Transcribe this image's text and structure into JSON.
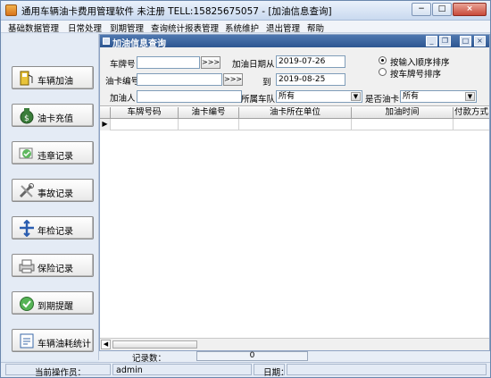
{
  "window": {
    "title": "通用车辆油卡费用管理软件 未注册 TELL:15825675057 - [加油信息查询]",
    "controls": {
      "minimize": "−",
      "maximize": "□",
      "close": "×"
    }
  },
  "menu": [
    "基础数据管理",
    "日常处理",
    "到期管理",
    "查询统计报表管理",
    "系统维护",
    "退出管理",
    "帮助"
  ],
  "sidebar": [
    {
      "label": "车辆加油",
      "icon": "fuel-pump-icon"
    },
    {
      "label": "油卡充值",
      "icon": "money-bag-icon"
    },
    {
      "label": "违章记录",
      "icon": "violation-icon"
    },
    {
      "label": "事故记录",
      "icon": "accident-tools-icon"
    },
    {
      "label": "年检记录",
      "icon": "inspection-icon"
    },
    {
      "label": "保险记录",
      "icon": "insurance-printer-icon"
    },
    {
      "label": "到期提醒",
      "icon": "reminder-icon"
    },
    {
      "label": "车辆油耗统计",
      "icon": "statistics-icon"
    }
  ],
  "child": {
    "title": "加油信息查询",
    "controls": {
      "minimize": "_",
      "restore": "❐",
      "maximize": "□",
      "close": "×"
    }
  },
  "form": {
    "plate_label": "车牌号",
    "plate_value": "",
    "plate_btn": ">>>",
    "card_label": "油卡编号",
    "card_value": "",
    "card_btn": ">>>",
    "fueler_label": "加油人",
    "fueler_value": "",
    "date_from_label": "加油日期从",
    "date_from": "2019-07-26",
    "date_to_label": "到",
    "date_to": "2019-08-25",
    "fleet_label": "所属车队",
    "fleet_value": "所有",
    "use_card_label": "是否油卡",
    "use_card_value": "所有",
    "sort_options": [
      "按输入顺序排序",
      "按车牌号排序"
    ],
    "sort_selected": 0
  },
  "grid": {
    "columns": [
      "车牌号码",
      "油卡编号",
      "油卡所在单位",
      "加油时间",
      "付款方式"
    ],
    "row_marker": "▶"
  },
  "status": {
    "records_label": "记录数：",
    "records_value": "0"
  },
  "bottom": {
    "operator_label": "当前操作员：",
    "operator_value": "admin",
    "date_label": "日期：",
    "date_value": ""
  }
}
